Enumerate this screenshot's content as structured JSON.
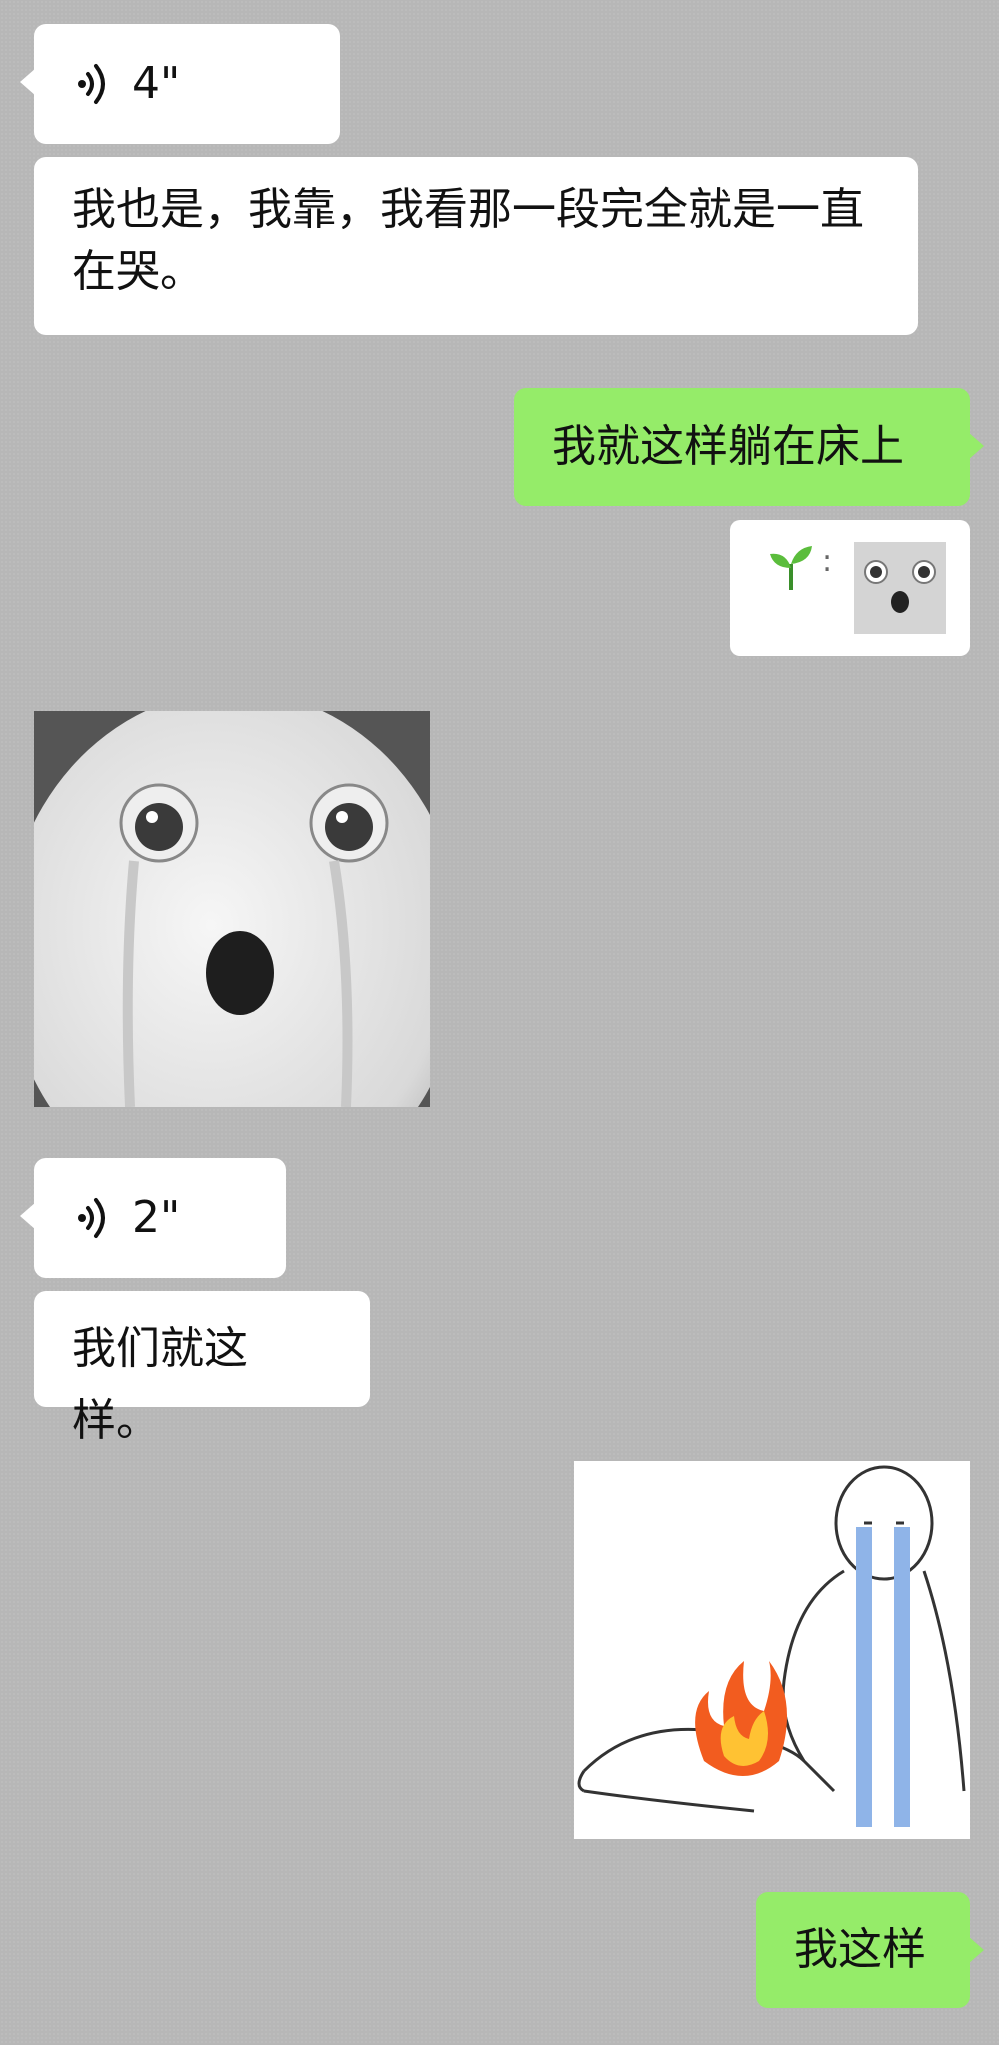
{
  "messages": {
    "voice_1": {
      "duration": "4\""
    },
    "text_1": "我也是，我靠，我看那一段完全就是一直在哭。",
    "text_2": "我就这样躺在床上",
    "reaction": {
      "separator": ":"
    },
    "voice_2": {
      "duration": "2\""
    },
    "text_3": "我们就这样。",
    "text_4": "我这样"
  },
  "colors": {
    "background": "#b7b7b7",
    "incoming_bubble": "#ffffff",
    "outgoing_bubble": "#95ec69"
  },
  "icons": {
    "voice": "voice-wave-icon",
    "reaction": "seedling-icon"
  }
}
